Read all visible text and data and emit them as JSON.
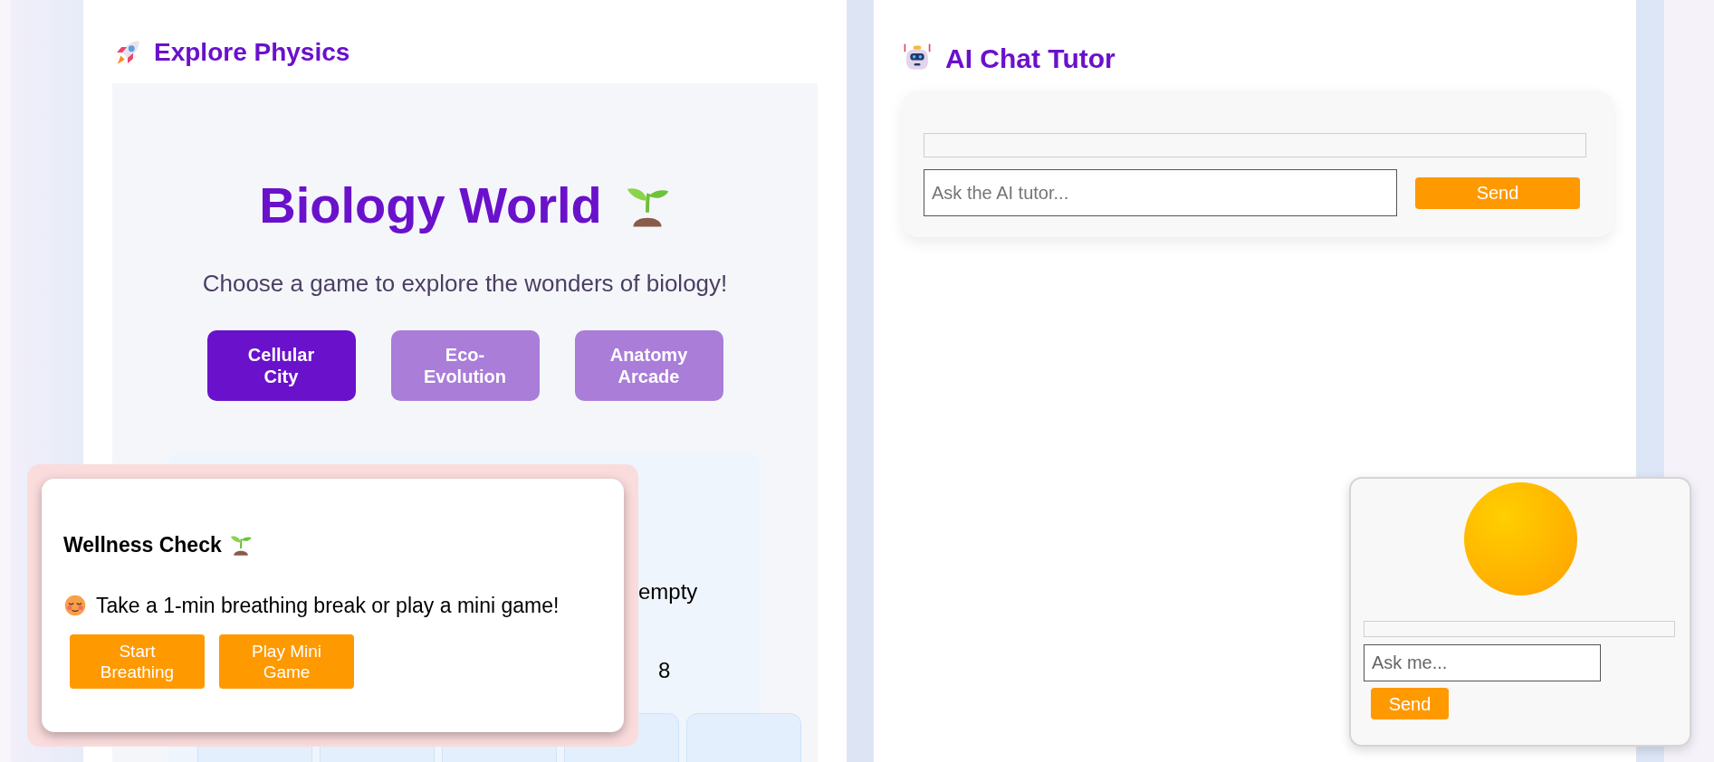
{
  "explore_panel": {
    "title": "Explore Physics",
    "game_picker": {
      "title": "Biology World",
      "subtitle": "Choose a game to explore the wonders of biology!",
      "games": [
        {
          "label": "Cellular City",
          "selected": true
        },
        {
          "label": "Eco-Evolution",
          "selected": false
        },
        {
          "label": "Anatomy Arcade",
          "selected": false
        }
      ]
    },
    "game_area": {
      "texts": [
        "empty",
        "8"
      ]
    }
  },
  "wellness_popup": {
    "title": "Wellness Check",
    "message": "Take a 1-min breathing break or play a mini game!",
    "buttons": [
      "Start Breathing",
      "Play Mini Game"
    ]
  },
  "chat_tutor": {
    "title": "AI Chat Tutor",
    "input": {
      "placeholder": "Ask the AI tutor..."
    },
    "send": "Send"
  },
  "mini_assistant": {
    "input": {
      "placeholder": "Ask me..."
    },
    "send": "Send"
  }
}
